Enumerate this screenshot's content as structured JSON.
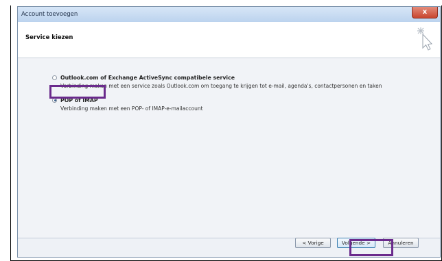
{
  "window": {
    "title": "Account toevoegen",
    "close_label": "x"
  },
  "header": {
    "title": "Service kiezen",
    "icon": "wizard-cursor-icon"
  },
  "options": [
    {
      "label": "Outlook.com of Exchange ActiveSync compatibele service",
      "description": "Verbinding maken met een service zoals Outlook.com om toegang te krijgen tot e-mail, agenda's, contactpersonen en taken",
      "selected": false
    },
    {
      "label": "POP of IMAP",
      "description": "Verbinding maken met een POP- of IMAP-e-mailaccount",
      "selected": true
    }
  ],
  "buttons": {
    "back": "< Vorige",
    "next": "Volgende >",
    "cancel": "Annuleren"
  },
  "colors": {
    "highlight": "#6a2a8c",
    "titlebar": "#c8dbf2",
    "close": "#c8462f"
  }
}
